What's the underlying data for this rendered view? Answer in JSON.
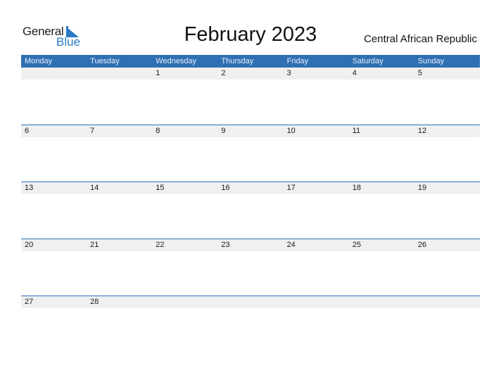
{
  "logo": {
    "line1": "General",
    "line2": "Blue"
  },
  "title": "February 2023",
  "country": "Central African Republic",
  "colors": {
    "header_bg": "#2e70b3",
    "accent": "#2a7bc6",
    "strip_bg": "#f0f0f0"
  },
  "weekdays": [
    "Monday",
    "Tuesday",
    "Wednesday",
    "Thursday",
    "Friday",
    "Saturday",
    "Sunday"
  ],
  "weeks": [
    [
      "",
      "",
      "1",
      "2",
      "3",
      "4",
      "5"
    ],
    [
      "6",
      "7",
      "8",
      "9",
      "10",
      "11",
      "12"
    ],
    [
      "13",
      "14",
      "15",
      "16",
      "17",
      "18",
      "19"
    ],
    [
      "20",
      "21",
      "22",
      "23",
      "24",
      "25",
      "26"
    ],
    [
      "27",
      "28",
      "",
      "",
      "",
      "",
      ""
    ]
  ]
}
